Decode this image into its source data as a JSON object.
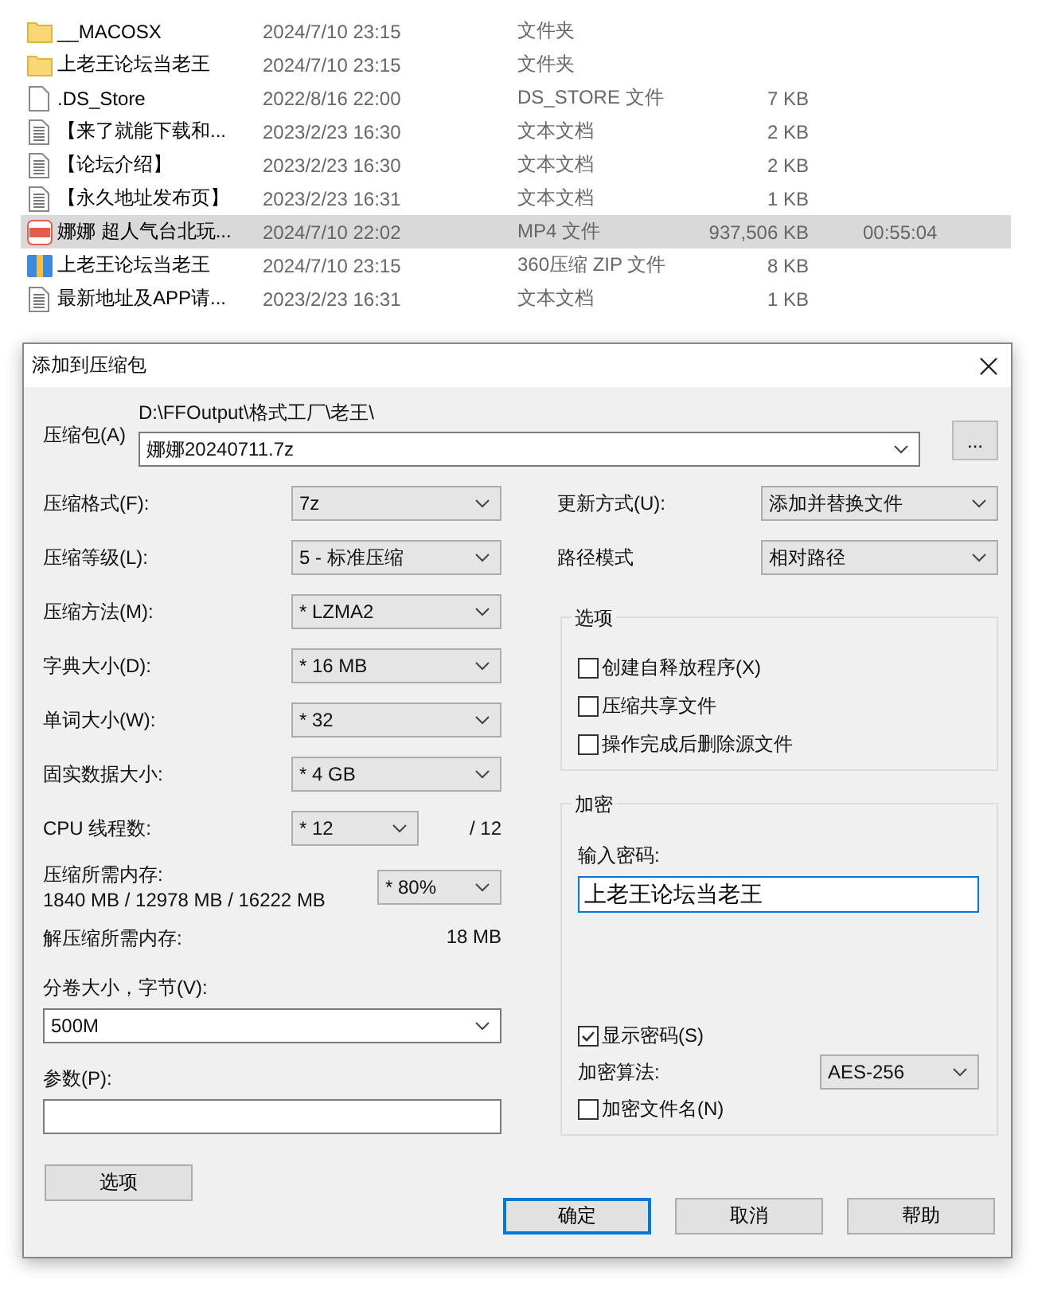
{
  "file_list": {
    "rows": [
      {
        "kind": "folder",
        "name": "__MACOSX",
        "modified": "2024/7/10 23:15",
        "type": "文件夹",
        "selected": false
      },
      {
        "kind": "folder",
        "name": "上老王论坛当老王",
        "modified": "2024/7/10 23:15",
        "type": "文件夹",
        "selected": false
      },
      {
        "kind": "file",
        "name": ".DS_Store",
        "modified": "2022/8/16 22:00",
        "type": "DS_STORE 文件",
        "size": "7 KB",
        "selected": false
      },
      {
        "kind": "text",
        "name": "【来了就能下载和...",
        "modified": "2023/2/23 16:30",
        "type": "文本文档",
        "size": "2 KB",
        "selected": false
      },
      {
        "kind": "text",
        "name": "【论坛介绍】",
        "modified": "2023/2/23 16:30",
        "type": "文本文档",
        "size": "2 KB",
        "selected": false
      },
      {
        "kind": "text",
        "name": "【永久地址发布页】",
        "modified": "2023/2/23 16:31",
        "type": "文本文档",
        "size": "1 KB",
        "selected": false
      },
      {
        "kind": "video",
        "name": "娜娜 超人气台北玩...",
        "modified": "2024/7/10 22:02",
        "type": "MP4 文件",
        "size": "937,506 KB",
        "duration": "00:55:04",
        "selected": true
      },
      {
        "kind": "archive",
        "name": "上老王论坛当老王",
        "modified": "2024/7/10 23:15",
        "type": "360压缩 ZIP 文件",
        "size": "8 KB",
        "selected": false
      },
      {
        "kind": "text",
        "name": "最新地址及APP请...",
        "modified": "2023/2/23 16:31",
        "type": "文本文档",
        "size": "1 KB",
        "selected": false
      }
    ]
  },
  "dialog": {
    "title": "添加到压缩包",
    "archive": {
      "label": "压缩包(A)",
      "path": "D:\\FFOutput\\格式工厂\\老王\\",
      "value": "娜娜20240711.7z",
      "browse_button": "..."
    },
    "settings": [
      {
        "label": "压缩格式(F):",
        "value": "7z"
      },
      {
        "label": "压缩等级(L):",
        "value": "5 - 标准压缩"
      },
      {
        "label": "压缩方法(M):",
        "value": "* LZMA2"
      },
      {
        "label": "字典大小(D):",
        "value": "* 16 MB"
      },
      {
        "label": "单词大小(W):",
        "value": "* 32"
      },
      {
        "label": "固实数据大小:",
        "value": "* 4 GB"
      }
    ],
    "cpu_threads": {
      "label": "CPU 线程数:",
      "value": "* 12",
      "max": "/ 12"
    },
    "memory": {
      "label": "压缩所需内存:",
      "usage": "1840 MB / 12978 MB / 16222 MB",
      "value": "* 80%"
    },
    "decompress_memory": {
      "label": "解压缩所需内存:",
      "value": "18 MB"
    },
    "volume_size": {
      "label": "分卷大小，字节(V):",
      "value": "500M"
    },
    "parameters": {
      "label": "参数(P):"
    },
    "options_button": "选项",
    "update_mode": {
      "label": "更新方式(U):",
      "value": "添加并替换文件"
    },
    "path_mode": {
      "label": "路径模式",
      "value": "相对路径"
    },
    "options_group": {
      "title": "选项",
      "checkboxes": [
        {
          "label": "创建自释放程序(X)",
          "checked": false
        },
        {
          "label": "压缩共享文件",
          "checked": false
        },
        {
          "label": "操作完成后删除源文件",
          "checked": false
        }
      ]
    },
    "encryption": {
      "title": "加密",
      "password_label": "输入密码:",
      "password": "上老王论坛当老王",
      "show_password": {
        "label": "显示密码(S)",
        "checked": true
      },
      "method_label": "加密算法:",
      "method": "AES-256",
      "encrypt_names": {
        "label": "加密文件名(N)",
        "checked": false
      }
    },
    "buttons": [
      {
        "label": "确定",
        "default": true
      },
      {
        "label": "取消",
        "default": false
      },
      {
        "label": "帮助",
        "default": false
      }
    ]
  }
}
